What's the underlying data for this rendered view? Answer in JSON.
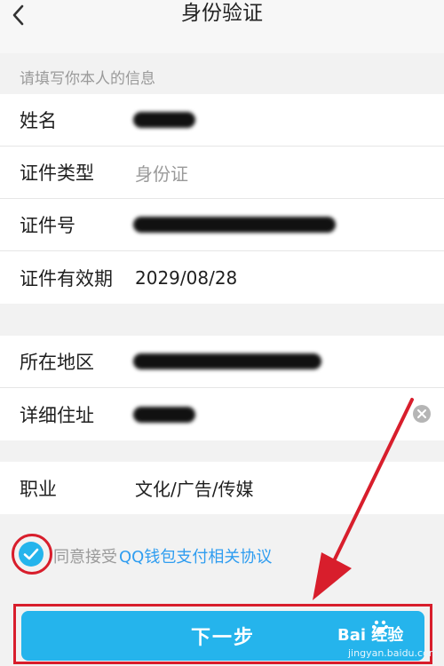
{
  "header": {
    "title": "身份验证"
  },
  "section_hint": "请填写你本人的信息",
  "identity": {
    "name_label": "姓名",
    "id_type_label": "证件类型",
    "id_type_value": "身份证",
    "id_number_label": "证件号",
    "validity_label": "证件有效期",
    "validity_value": "2029/08/28"
  },
  "address": {
    "region_label": "所在地区",
    "detail_label": "详细住址"
  },
  "job": {
    "label": "职业",
    "value": "文化/广告/传媒"
  },
  "agreement": {
    "prefix": "同意接受",
    "link": "QQ钱包支付相关协议"
  },
  "next_button": {
    "label": "下一步"
  },
  "watermark": {
    "brand": "Bai 经验",
    "url": "jingyan.baidu.com"
  },
  "colors": {
    "accent": "#25b4ec",
    "link": "#2f9df0",
    "annotation": "#d81e2c"
  },
  "icons": [
    "back-icon",
    "clear-icon",
    "check-icon",
    "paw-icon"
  ]
}
